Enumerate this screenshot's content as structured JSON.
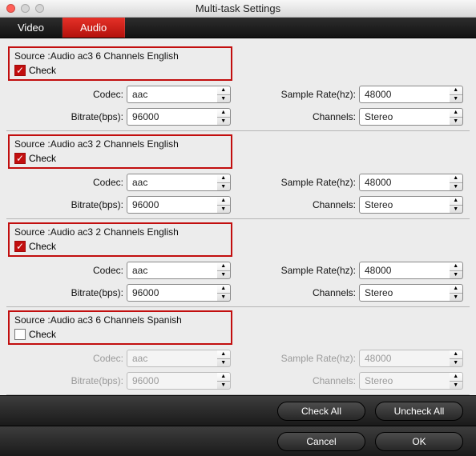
{
  "window": {
    "title": "Multi-task Settings"
  },
  "tabs": {
    "video": "Video",
    "audio": "Audio",
    "active": "audio"
  },
  "labels": {
    "codec": "Codec:",
    "bitrate": "Bitrate(bps):",
    "sampleRate": "Sample Rate(hz):",
    "channels": "Channels:",
    "check": "Check"
  },
  "tracks": [
    {
      "source": "Source :Audio  ac3  6 Channels  English",
      "checked": true,
      "codec": "aac",
      "bitrate": "96000",
      "sampleRate": "48000",
      "channels": "Stereo",
      "enabled": true
    },
    {
      "source": "Source :Audio  ac3  2 Channels  English",
      "checked": true,
      "codec": "aac",
      "bitrate": "96000",
      "sampleRate": "48000",
      "channels": "Stereo",
      "enabled": true
    },
    {
      "source": "Source :Audio  ac3  2 Channels  English",
      "checked": true,
      "codec": "aac",
      "bitrate": "96000",
      "sampleRate": "48000",
      "channels": "Stereo",
      "enabled": true
    },
    {
      "source": "Source :Audio  ac3  6 Channels  Spanish",
      "checked": false,
      "codec": "aac",
      "bitrate": "96000",
      "sampleRate": "48000",
      "channels": "Stereo",
      "enabled": false
    }
  ],
  "buttons": {
    "checkAll": "Check All",
    "uncheckAll": "Uncheck All",
    "cancel": "Cancel",
    "ok": "OK"
  }
}
